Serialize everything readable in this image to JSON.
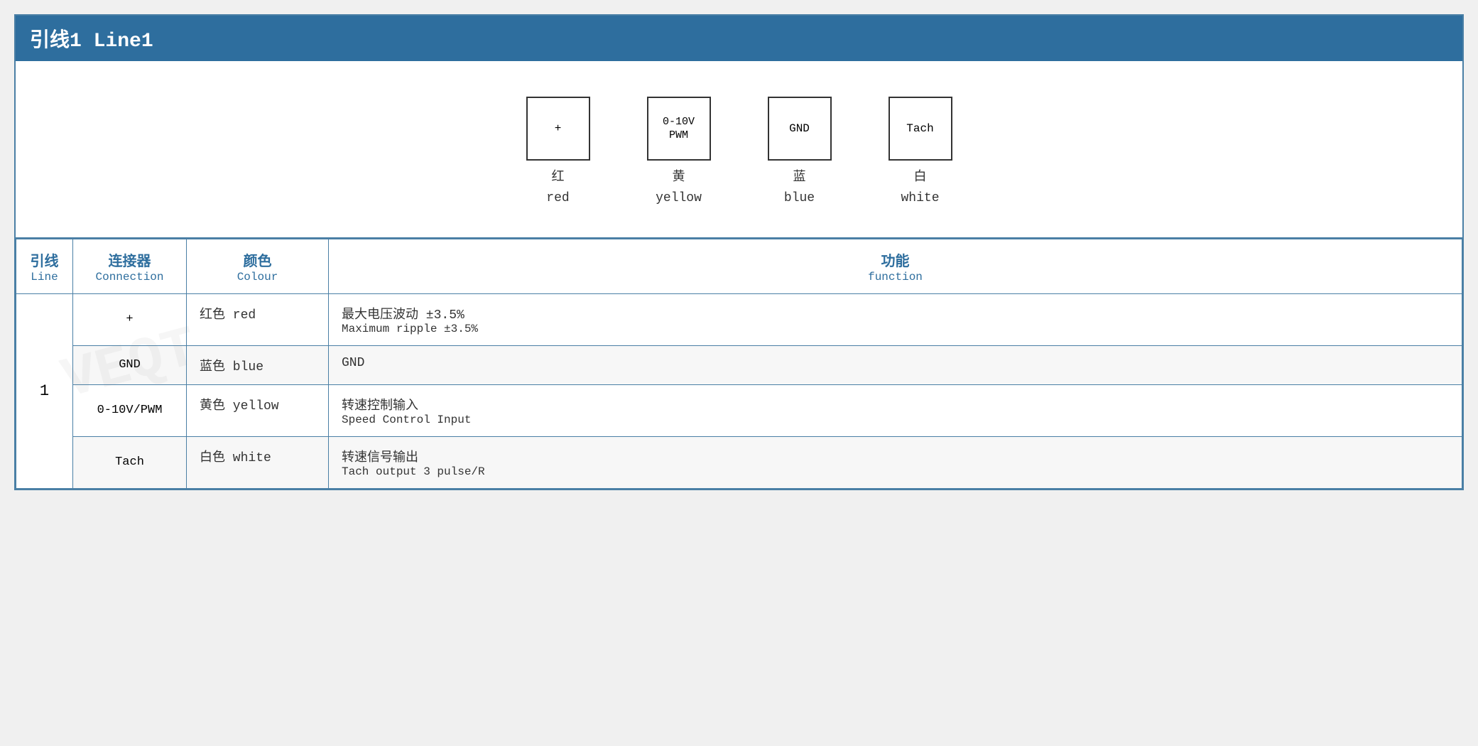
{
  "header": {
    "title": "引线1 Line1"
  },
  "diagram": {
    "pins": [
      {
        "id": "pin-plus",
        "box_label": "+",
        "chinese_label": "红",
        "english_label": "red"
      },
      {
        "id": "pin-pwm",
        "box_label": "0-10V\nPWM",
        "chinese_label": "黄",
        "english_label": "yellow"
      },
      {
        "id": "pin-gnd",
        "box_label": "GND",
        "chinese_label": "蓝",
        "english_label": "blue"
      },
      {
        "id": "pin-tach",
        "box_label": "Tach",
        "chinese_label": "白",
        "english_label": "white"
      }
    ]
  },
  "table": {
    "headers": {
      "line_chinese": "引线",
      "line_english": "Line",
      "connection_chinese": "连接器",
      "connection_english": "Connection",
      "colour_chinese": "颜色",
      "colour_english": "Colour",
      "function_chinese": "功能",
      "function_english": "function"
    },
    "rows": [
      {
        "line": "1",
        "connector": "+",
        "colour_chinese": "红色 red",
        "function_chinese": "最大电压波动 ±3.5%",
        "function_english": "Maximum ripple ±3.5%"
      },
      {
        "line": "",
        "connector": "GND",
        "colour_chinese": "蓝色 blue",
        "function_chinese": "GND",
        "function_english": ""
      },
      {
        "line": "",
        "connector": "0-10V/PWM",
        "colour_chinese": "黄色 yellow",
        "function_chinese": "转速控制输入",
        "function_english": "Speed Control Input"
      },
      {
        "line": "",
        "connector": "Tach",
        "colour_chinese": "白色 white",
        "function_chinese": "转速信号输出",
        "function_english": "Tach output 3 pulse/R"
      }
    ]
  }
}
